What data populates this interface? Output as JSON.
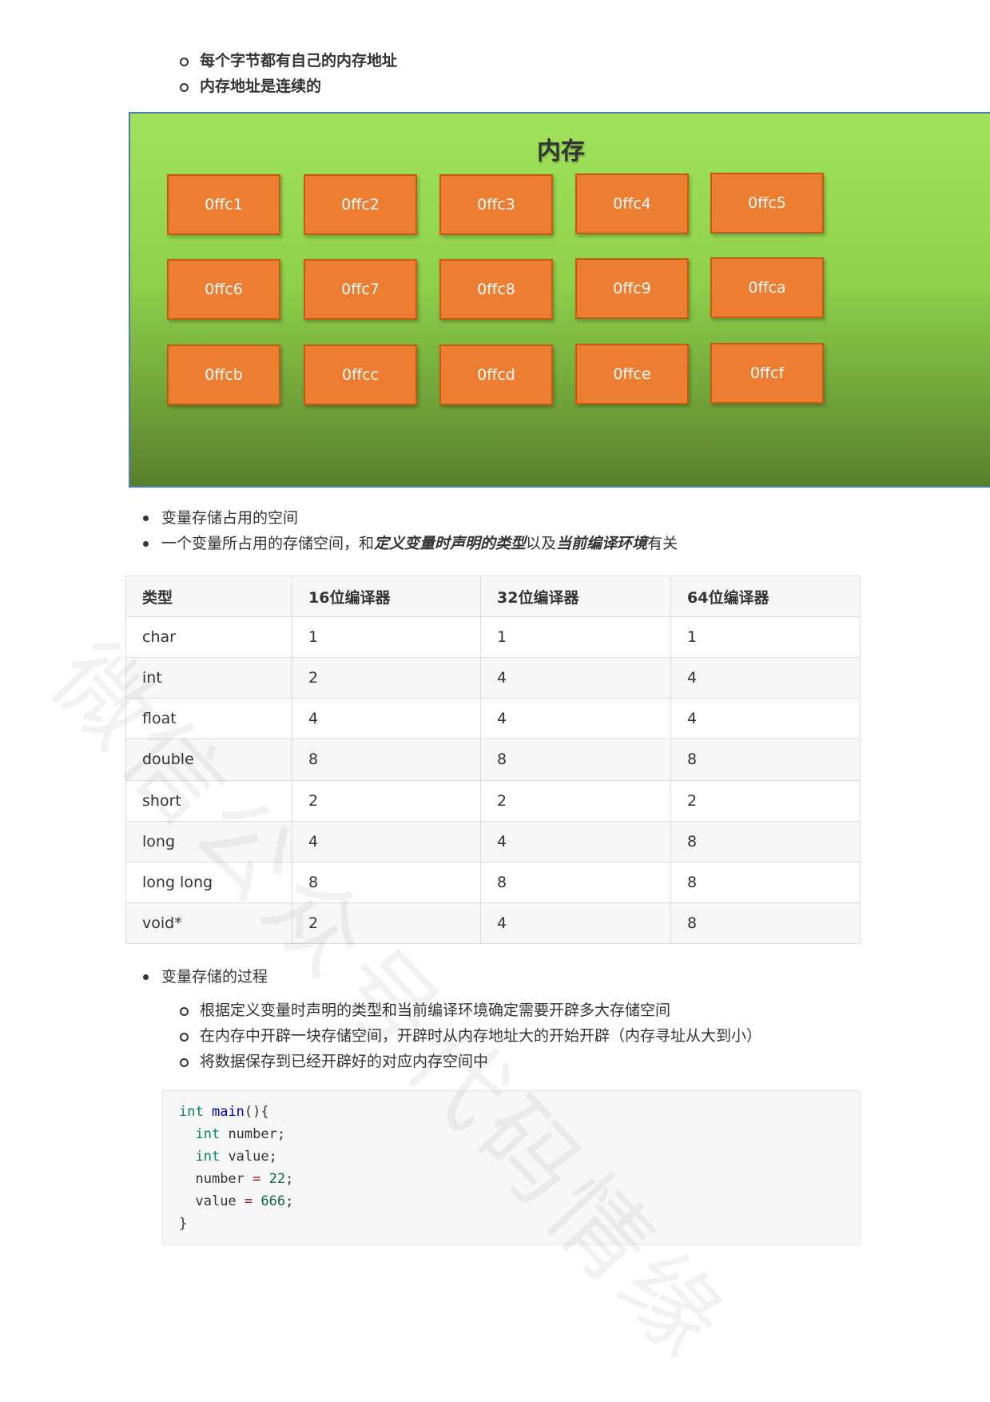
{
  "top_list": [
    "每个字节都有自己的内存地址",
    "内存地址是连续的"
  ],
  "memory_diagram": {
    "title": "内存",
    "cells": [
      "0ffc1",
      "0ffc2",
      "0ffc3",
      "0ffc4",
      "0ffc5",
      "0ffc6",
      "0ffc7",
      "0ffc8",
      "0ffc9",
      "0ffca",
      "0ffcb",
      "0ffcc",
      "0ffcd",
      "0ffce",
      "0ffcf"
    ],
    "background_color": "#a0e35b",
    "cell_color": "#ed7d31"
  },
  "para2": {
    "item1": "变量存储占用的空间",
    "item2_prefix": "一个变量所占用的存储空间，和",
    "item2_emph1": "定义变量时声明的类型",
    "item2_mid": "以及",
    "item2_emph2": "当前编译环境",
    "item2_suffix": "有关"
  },
  "table": {
    "headers": [
      "类型",
      "16位编译器",
      "32位编译器",
      "64位编译器"
    ],
    "rows": [
      [
        "char",
        "1",
        "1",
        "1"
      ],
      [
        "int",
        "2",
        "4",
        "4"
      ],
      [
        "float",
        "4",
        "4",
        "4"
      ],
      [
        "double",
        "8",
        "8",
        "8"
      ],
      [
        "short",
        "2",
        "2",
        "2"
      ],
      [
        "long",
        "4",
        "4",
        "8"
      ],
      [
        "long long",
        "8",
        "8",
        "8"
      ],
      [
        "void*",
        "2",
        "4",
        "8"
      ]
    ]
  },
  "para3": {
    "item": "变量存储的过程"
  },
  "sub_list2": [
    "根据定义变量时声明的类型和当前编译环境确定需要开辟多大存储空间",
    "在内存中开辟一块存储空间，开辟时从内存地址大的开始开辟（内存寻址从大到小）",
    "将数据保存到已经开辟好的对应内存空间中"
  ],
  "code": {
    "l1_kw": "int",
    "l1_fn": "main",
    "l1_rest": "(){",
    "l2_kw": "int",
    "l2_rest": " number;",
    "l3_kw": "int",
    "l3_rest": " value;",
    "l4_a": "number ",
    "l4_op": "=",
    "l4_num": "22",
    "l4_end": ";",
    "l5_a": "value ",
    "l5_op": "=",
    "l5_num": "666",
    "l5_end": ";",
    "l6": "}"
  },
  "watermark": "微信公众号代码情缘"
}
